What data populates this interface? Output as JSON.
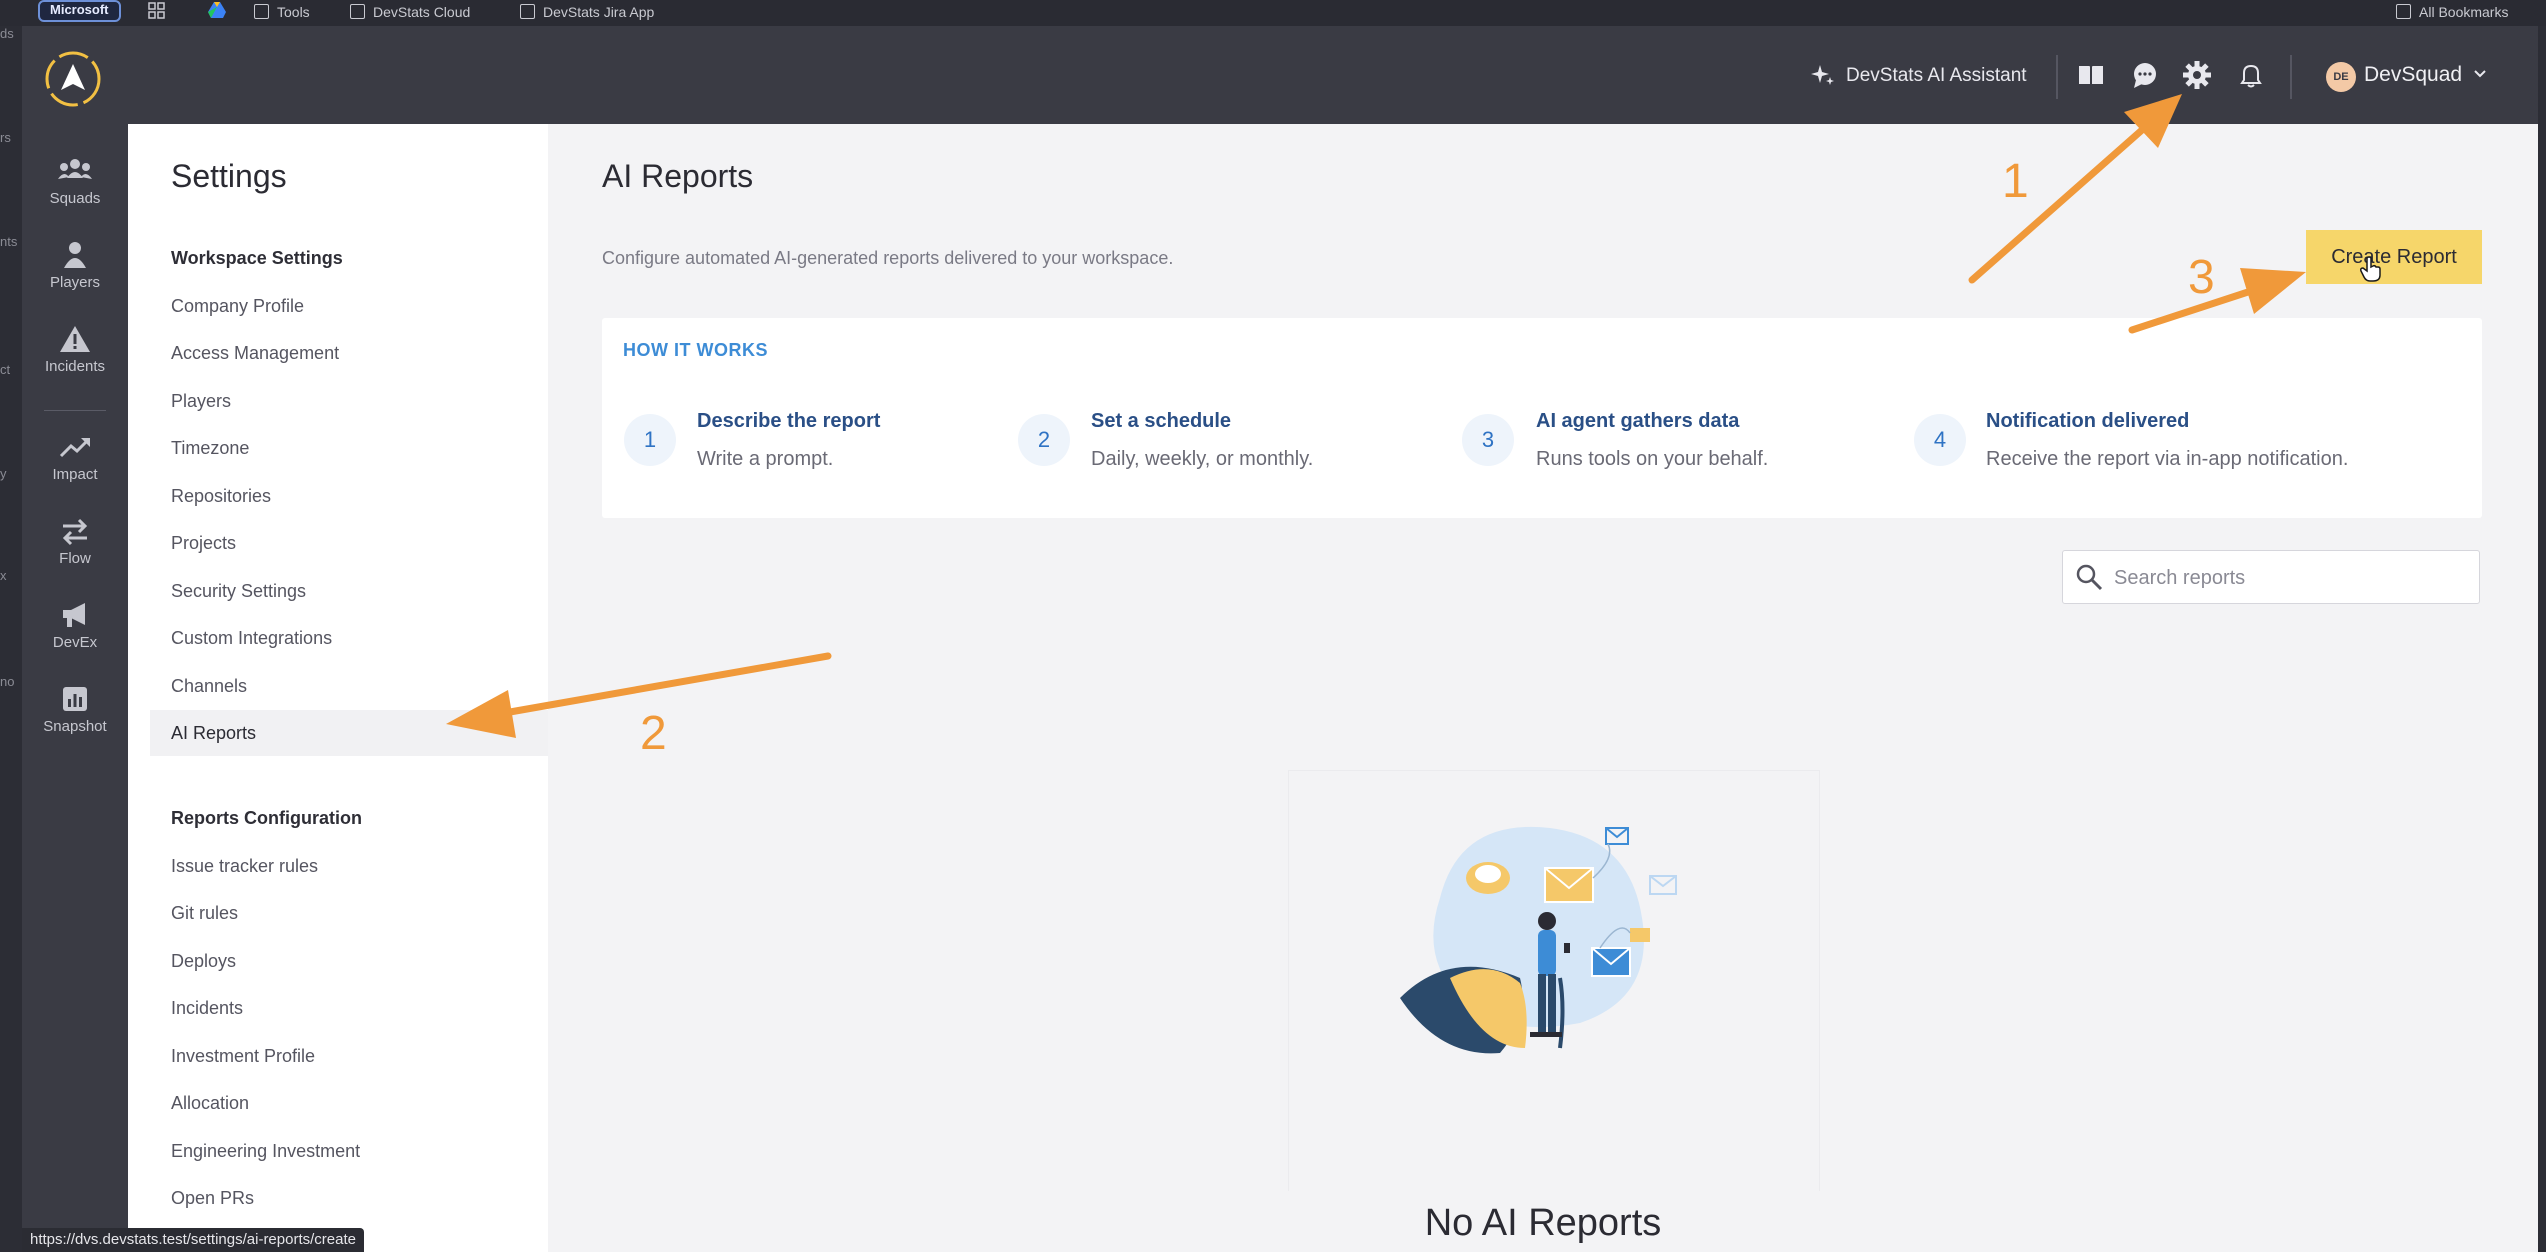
{
  "browser": {
    "badge": "Microsoft",
    "bookmarks": [
      "Tools",
      "DevStats Cloud",
      "DevStats Jira App"
    ],
    "all_bookmarks": "All Bookmarks",
    "left_edge_fragments": [
      "ds",
      "rs",
      "nts",
      "ct",
      "y",
      "x",
      "no"
    ]
  },
  "header": {
    "assistant_label": "DevStats AI Assistant",
    "avatar_initials": "DE",
    "user_name": "DevSquad"
  },
  "app_nav": [
    "Squads",
    "Players",
    "Incidents",
    "Impact",
    "Flow",
    "DevEx",
    "Snapshot"
  ],
  "settings": {
    "title": "Settings",
    "workspace_header": "Workspace Settings",
    "workspace_items": [
      "Company Profile",
      "Access Management",
      "Players",
      "Timezone",
      "Repositories",
      "Projects",
      "Security Settings",
      "Custom Integrations",
      "Channels",
      "AI Reports"
    ],
    "reports_header": "Reports Configuration",
    "reports_items": [
      "Issue tracker rules",
      "Git rules",
      "Deploys",
      "Incidents",
      "Investment Profile",
      "Allocation",
      "Engineering Investment",
      "Open PRs"
    ],
    "active_item": "AI Reports"
  },
  "main": {
    "title": "AI Reports",
    "subtitle": "Configure automated AI-generated reports delivered to your workspace.",
    "create_button": "Create Report",
    "how_title": "HOW IT WORKS",
    "steps": [
      {
        "num": "1",
        "title": "Describe the report",
        "desc": "Write a prompt."
      },
      {
        "num": "2",
        "title": "Set a schedule",
        "desc": "Daily, weekly, or monthly."
      },
      {
        "num": "3",
        "title": "AI agent gathers data",
        "desc": "Runs tools on your behalf."
      },
      {
        "num": "4",
        "title": "Notification delivered",
        "desc": "Receive the report via in-app notification."
      }
    ],
    "search_placeholder": "Search reports",
    "empty_title": "No AI Reports"
  },
  "status_url": "https://dvs.devstats.test/settings/ai-reports/create",
  "annotations": {
    "n1": "1",
    "n2": "2",
    "n3": "3",
    "color": "#f0993a"
  }
}
